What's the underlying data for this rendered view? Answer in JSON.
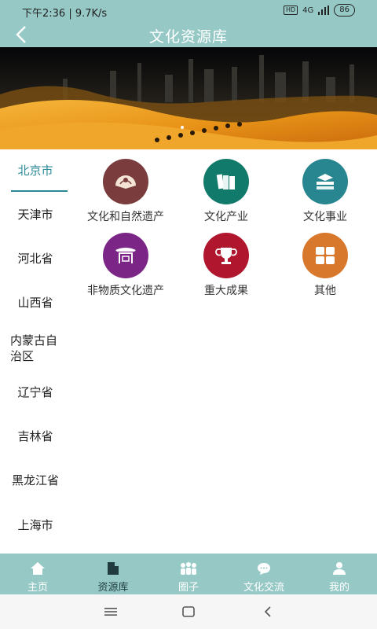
{
  "status": {
    "time_speed": "下午2:36 | 9.7K/s",
    "hd": "HD",
    "network": "4G",
    "battery": "86"
  },
  "header": {
    "title": "文化资源库"
  },
  "sidebar": {
    "items": [
      {
        "label": "北京市"
      },
      {
        "label": "天津市"
      },
      {
        "label": "河北省"
      },
      {
        "label": "山西省"
      },
      {
        "label": "内蒙古自治区"
      },
      {
        "label": "辽宁省"
      },
      {
        "label": "吉林省"
      },
      {
        "label": "黑龙江省"
      },
      {
        "label": "上海市"
      }
    ]
  },
  "categories": [
    {
      "label": "文化和自然遗产",
      "color": "#7a3c3c",
      "icon": "fan-icon"
    },
    {
      "label": "文化产业",
      "color": "#127a6a",
      "icon": "books-icon"
    },
    {
      "label": "文化事业",
      "color": "#27868f",
      "icon": "stacked-books-icon"
    },
    {
      "label": "非物质文化遗产",
      "color": "#7b2687",
      "icon": "pavilion-icon"
    },
    {
      "label": "重大成果",
      "color": "#b0172e",
      "icon": "trophy-icon"
    },
    {
      "label": "其他",
      "color": "#d8782c",
      "icon": "grid-icon"
    }
  ],
  "tabbar": {
    "items": [
      {
        "label": "主页",
        "icon": "home-icon"
      },
      {
        "label": "资源库",
        "icon": "file-icon"
      },
      {
        "label": "圈子",
        "icon": "people-icon"
      },
      {
        "label": "文化交流",
        "icon": "chat-icon"
      },
      {
        "label": "我的",
        "icon": "user-icon"
      }
    ]
  },
  "colors": {
    "primary": "#96c9c6",
    "accent": "#2c8a96"
  }
}
